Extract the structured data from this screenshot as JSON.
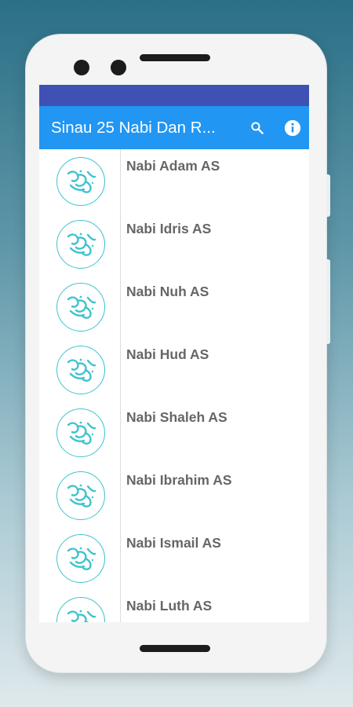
{
  "app": {
    "title": "Sinau 25 Nabi Dan R...",
    "accent_color": "#2196f3",
    "statusbar_color": "#3f51b5",
    "actions": [
      {
        "name": "search",
        "icon": "search-icon"
      },
      {
        "name": "info",
        "icon": "info-icon"
      }
    ]
  },
  "list": {
    "thumbnail_icon": "muhammad-calligraphy-icon",
    "items": [
      {
        "label": "Nabi Adam AS"
      },
      {
        "label": "Nabi Idris AS"
      },
      {
        "label": "Nabi Nuh AS"
      },
      {
        "label": "Nabi Hud AS"
      },
      {
        "label": "Nabi Shaleh AS"
      },
      {
        "label": "Nabi Ibrahim AS"
      },
      {
        "label": "Nabi Ismail AS"
      },
      {
        "label": "Nabi Luth AS"
      }
    ]
  }
}
